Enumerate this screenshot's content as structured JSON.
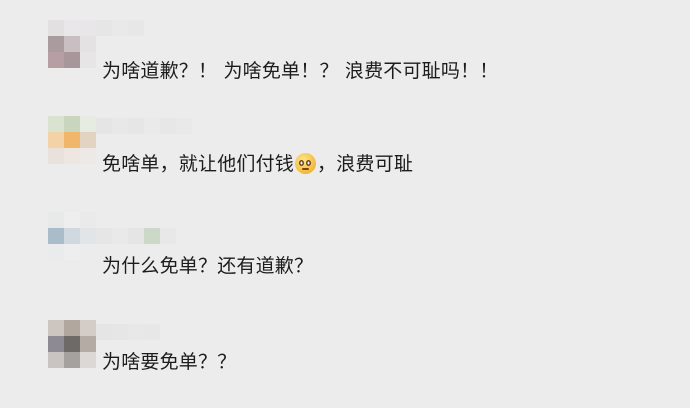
{
  "comments": [
    {
      "text_parts": [
        "为啥道歉？！ 为啥免单！？ 浪费不可耻吗！！"
      ],
      "avatar_tiles": [
        "#e3e0e2",
        "#eae7ea",
        "#e8e6e8",
        "#aa9b9f",
        "#c9bec2",
        "#e4e2e3",
        "#b79ea3",
        "#a8979a",
        "#e7e5e6"
      ],
      "name_tiles": [
        "#e6e6e6",
        "#e9e9e9",
        "#e7e7e7",
        "#ececec"
      ]
    },
    {
      "text_parts": [
        "免啥单，就让他们付钱",
        "，浪费可耻"
      ],
      "emoji": "pleading-face",
      "avatar_tiles": [
        "#d9e3cf",
        "#c9d6bd",
        "#e6ece1",
        "#f2d2a6",
        "#f0b76a",
        "#e3d4c2",
        "#e9e2dc",
        "#ede6e1",
        "#ece9e6"
      ],
      "name_tiles": [
        "#e5e5e5",
        "#e8e8e8",
        "#e6e6e6",
        "#eaeaea",
        "#e7e7e7",
        "#e9e9e9"
      ]
    },
    {
      "text_parts": [
        "为什么免单？还有道歉？"
      ],
      "avatar_tiles": [
        "#e8eae9",
        "#eeeeee",
        "#eaeaea",
        "#a8bcc9",
        "#cfd9df",
        "#e1e5e7",
        "#e9ebec",
        "#eeeeee",
        "#ececec"
      ],
      "name_tiles": [
        "#e6e6e6",
        "#e9e9e9",
        "#e5e5e5",
        "#cdd9c8",
        "#e8e8e8"
      ]
    },
    {
      "text_parts": [
        "为啥要免单？？"
      ],
      "avatar_tiles": [
        "#cdc5c0",
        "#b2a79f",
        "#d3ccc7",
        "#8e8a93",
        "#6d6a68",
        "#b3aba4",
        "#c9c4c1",
        "#a5a19f",
        "#dcd8d5"
      ],
      "name_tiles": [
        "#e5e5e5",
        "#e6e6e6",
        "#e8e8e8",
        "#e7e7e7"
      ]
    }
  ]
}
